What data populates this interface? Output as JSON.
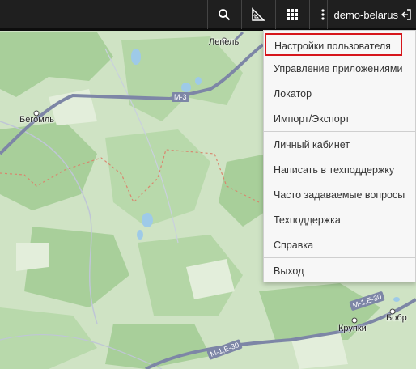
{
  "topbar": {
    "username": "demo-belarus",
    "icons": [
      "search-icon",
      "ruler-icon",
      "apps-grid-icon",
      "more-vert-icon",
      "logout-icon"
    ]
  },
  "user_menu": {
    "items": [
      {
        "label": "Настройки пользователя",
        "selected": true
      },
      {
        "label": "Управление приложениями"
      },
      {
        "label": "Локатор"
      },
      {
        "label": "Импорт/Экспорт"
      },
      {
        "label": "Личный кабинет"
      },
      {
        "label": "Написать в техподдержку"
      },
      {
        "label": "Часто задаваемые вопросы"
      },
      {
        "label": "Техподдержка"
      },
      {
        "label": "Справка"
      },
      {
        "label": "Выход"
      }
    ]
  },
  "map": {
    "places": [
      "Лепель",
      "Бегомль",
      "Крупки",
      "Бобр"
    ],
    "roads": [
      "M-3",
      "M-1,E-30",
      "M-1,E-30"
    ]
  },
  "colors": {
    "topbar": "#1f1f1f",
    "map_green": "#a8cf9a",
    "map_light": "#e3eedb",
    "road": "#7d86a6",
    "highlight_border": "#d6151b"
  }
}
